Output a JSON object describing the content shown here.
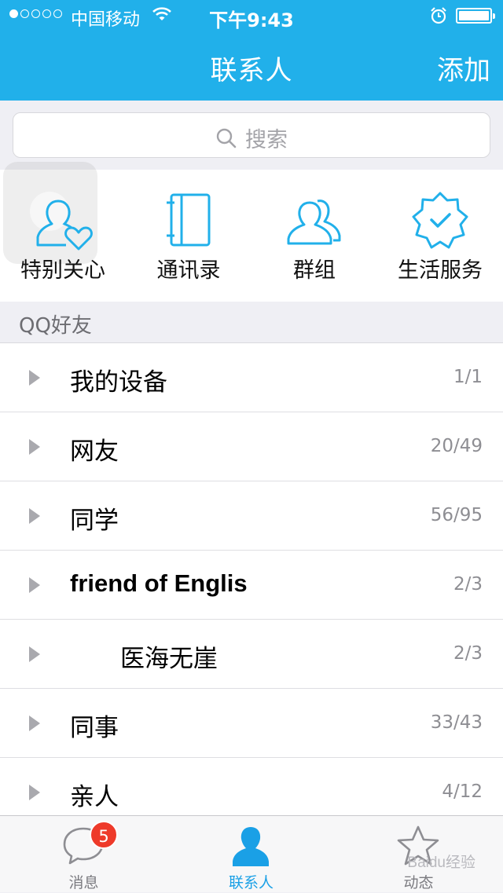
{
  "status": {
    "carrier": "中国移动",
    "time": "下午9:43",
    "signal_dots_filled": 1,
    "signal_dots_total": 5,
    "battery_level": 1.0
  },
  "nav": {
    "title": "联系人",
    "add_label": "添加"
  },
  "search": {
    "placeholder": "搜索"
  },
  "quick_items": [
    {
      "label": "特别关心",
      "icon": "special-care-icon"
    },
    {
      "label": "通讯录",
      "icon": "address-book-icon"
    },
    {
      "label": "群组",
      "icon": "groups-icon"
    },
    {
      "label": "生活服务",
      "icon": "life-services-icon"
    }
  ],
  "section": {
    "title": "QQ好友"
  },
  "groups": [
    {
      "name": "我的设备",
      "count": "1/1"
    },
    {
      "name": "网友",
      "count": "20/49"
    },
    {
      "name": "同学",
      "count": "56/95"
    },
    {
      "name": "friend of Englis",
      "count": "2/3"
    },
    {
      "name": "医海无崖",
      "count": "2/3"
    },
    {
      "name": "同事",
      "count": "33/43"
    },
    {
      "name": "亲人",
      "count": "4/12"
    }
  ],
  "tabs": [
    {
      "label": "消息",
      "badge": "5"
    },
    {
      "label": "联系人"
    },
    {
      "label": "动态"
    }
  ],
  "colors": {
    "accent": "#21b0ea",
    "badge": "#ee3a2a",
    "active_tab": "#1aa0e6"
  },
  "watermark": "Baidu经验"
}
